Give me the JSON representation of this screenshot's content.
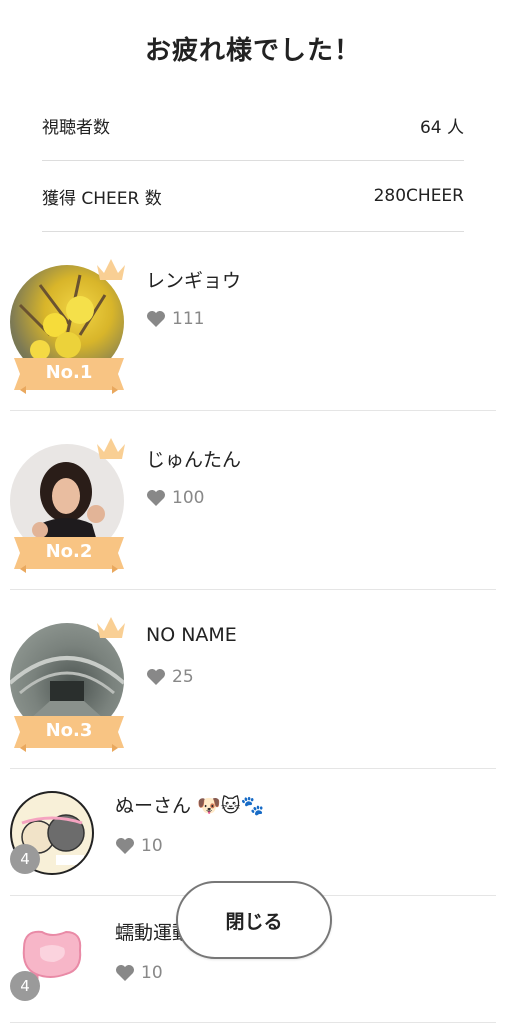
{
  "title": "お疲れ様でした！",
  "stats": [
    {
      "label": "視聴者数",
      "value": "64 人"
    },
    {
      "label": "獲得 CHEER 数",
      "value": "280CHEER"
    }
  ],
  "ranking": [
    {
      "rank_label": "No.1",
      "name": "レンギョウ",
      "likes": "111"
    },
    {
      "rank_label": "No.2",
      "name": "じゅんたん",
      "likes": "100"
    },
    {
      "rank_label": "No.3",
      "name": "NO NAME",
      "likes": "25"
    },
    {
      "rank_label": "4",
      "name": "ぬーさん 🐶🐱🐾",
      "likes": "10"
    },
    {
      "rank_label": "4",
      "name": "蠕動運動(ぜんどう)",
      "likes": "10"
    }
  ],
  "close_button": "閉じる",
  "colors": {
    "ribbon": "#f8c483",
    "ribbon_dark": "#e9a85e",
    "crown": "#f9cf94",
    "badge": "#9a9a9a",
    "heart": "#888888"
  }
}
